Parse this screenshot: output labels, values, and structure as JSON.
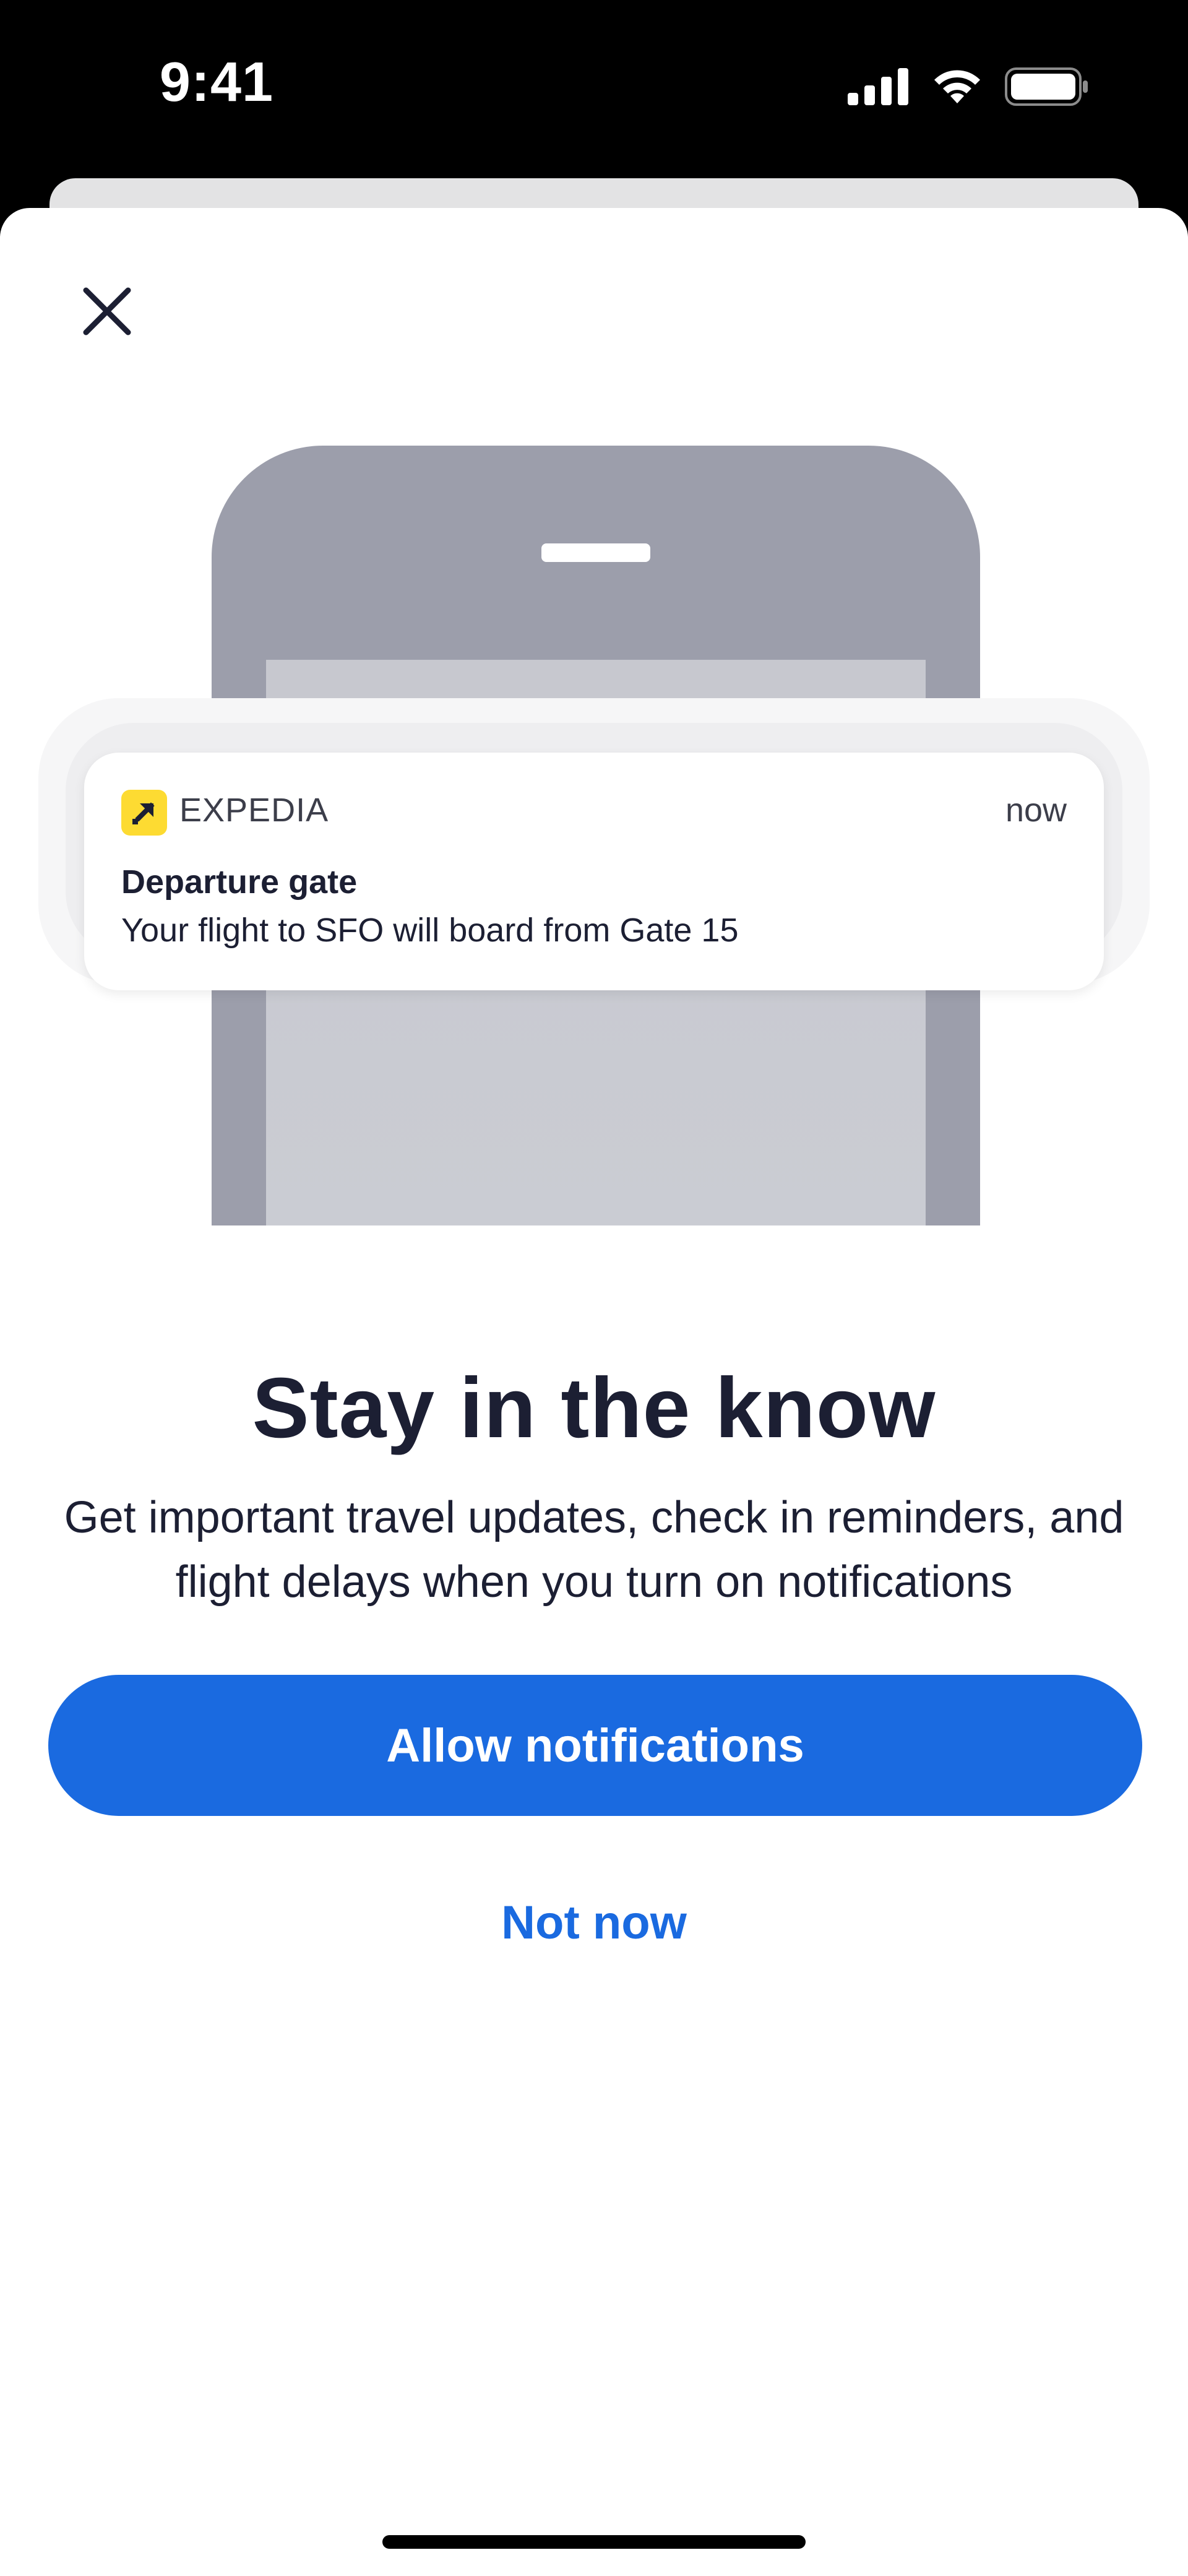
{
  "status_bar": {
    "time": "9:41",
    "icons": [
      "cellular-signal-icon",
      "wifi-icon",
      "battery-icon"
    ]
  },
  "close_icon": "close-icon",
  "illustration": {
    "notification": {
      "app_name": "EXPEDIA",
      "time": "now",
      "title": "Departure gate",
      "body": "Your flight to SFO will board from Gate 15",
      "app_icon": "expedia-logo-icon"
    }
  },
  "content": {
    "headline": "Stay in the know",
    "description": "Get important travel updates, check in reminders, and flight delays when you turn on notifications",
    "primary_button": "Allow notifications",
    "secondary_link": "Not now"
  },
  "colors": {
    "accent": "#1a6ae0",
    "text_primary": "#1c1f33",
    "brand_yellow": "#fddb32",
    "phone_gray": "#9c9eab"
  }
}
